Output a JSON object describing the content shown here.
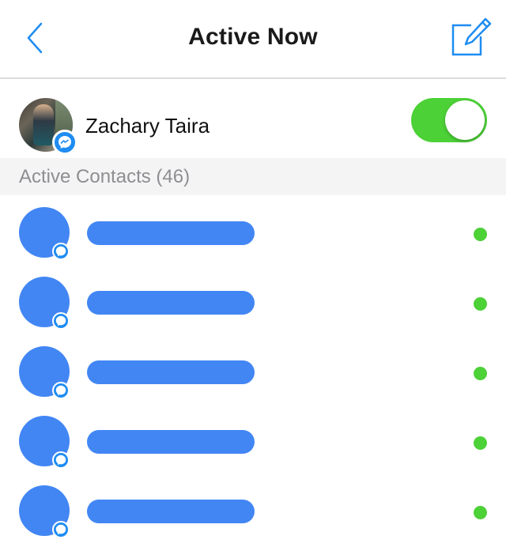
{
  "nav": {
    "title": "Active Now",
    "back_icon": "chevron-left-icon",
    "compose_icon": "compose-icon"
  },
  "me": {
    "name": "Zachary Taira",
    "active_toggle_on": true
  },
  "section": {
    "label": "Active Contacts (46)"
  },
  "contacts": [
    {
      "name_redacted": true,
      "online": true
    },
    {
      "name_redacted": true,
      "online": true
    },
    {
      "name_redacted": true,
      "online": true
    },
    {
      "name_redacted": true,
      "online": true
    },
    {
      "name_redacted": true,
      "online": true
    }
  ],
  "colors": {
    "accent_blue": "#1e8cf2",
    "online_green": "#4cd137",
    "redaction_blue": "#4286f4"
  }
}
